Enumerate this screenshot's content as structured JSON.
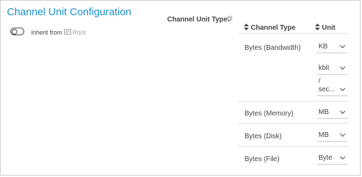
{
  "panel": {
    "title": "Channel Unit Configuration",
    "inherit_label": "inherit from",
    "root_label": "Root",
    "toggle_on": false
  },
  "channel_unit_types": {
    "label": "Channel Unit Types"
  },
  "table": {
    "columns": [
      "Channel Type",
      "Unit"
    ],
    "rows": [
      {
        "type": "Bytes (Bandwidth)",
        "unit": "KB",
        "unit2": "kbit",
        "unit3_sep": "/",
        "unit3": "sec..."
      },
      {
        "type": "Bytes (Memory)",
        "unit": "MB"
      },
      {
        "type": "Bytes (Disk)",
        "unit": "MB"
      },
      {
        "type": "Bytes (File)",
        "unit": "Byte"
      }
    ]
  },
  "colors": {
    "title": "#1a8fc9",
    "border": "#cfcfcf",
    "muted": "#a0a0a0"
  },
  "icons": {
    "toggle": "toggle-switch-icon",
    "root": "root-device-icon",
    "info": "info-icon",
    "sort": "sort-icon",
    "chevron": "chevron-down-icon"
  }
}
